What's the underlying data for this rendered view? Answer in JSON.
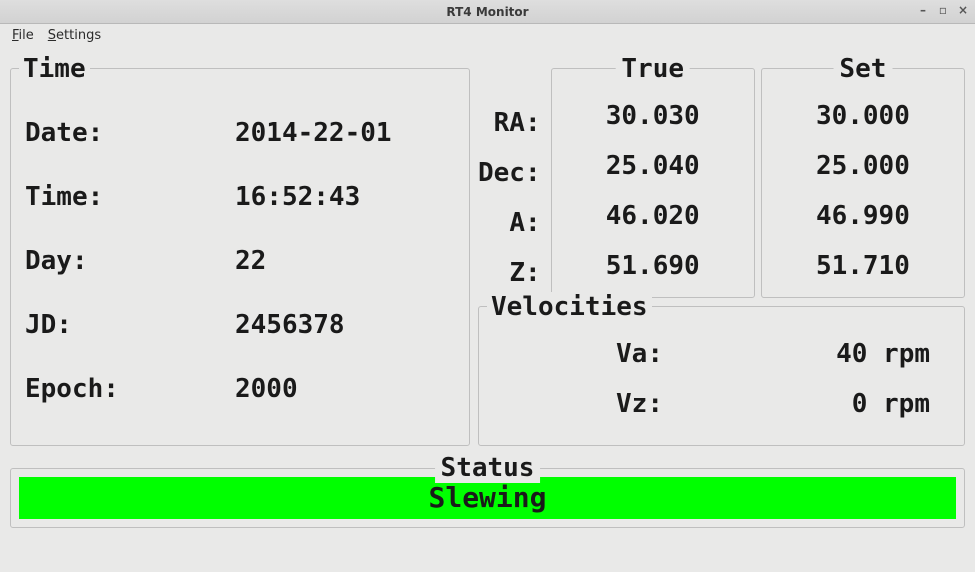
{
  "window": {
    "title": "RT4 Monitor"
  },
  "menu": {
    "file": "File",
    "settings": "Settings"
  },
  "time": {
    "title": "Time",
    "labels": {
      "date": "Date:",
      "time": "Time:",
      "day": "Day:",
      "jd": "JD:",
      "epoch": "Epoch:"
    },
    "values": {
      "date": "2014-22-01",
      "time": "16:52:43",
      "day": "22",
      "jd": "2456378",
      "epoch": "2000"
    }
  },
  "coords": {
    "true_title": "True",
    "set_title": "Set",
    "labels": {
      "ra": "RA:",
      "dec": "Dec:",
      "a": "A:",
      "z": "Z:"
    },
    "true_vals": {
      "ra": "30.030",
      "dec": "25.040",
      "a": "46.020",
      "z": "51.690"
    },
    "set_vals": {
      "ra": "30.000",
      "dec": "25.000",
      "a": "46.990",
      "z": "51.710"
    }
  },
  "velocities": {
    "title": "Velocities",
    "labels": {
      "va": "Va:",
      "vz": "Vz:"
    },
    "values": {
      "va": "40 rpm",
      "vz": "0 rpm"
    }
  },
  "status": {
    "title": "Status",
    "value": "Slewing",
    "color": "#00ff00"
  }
}
